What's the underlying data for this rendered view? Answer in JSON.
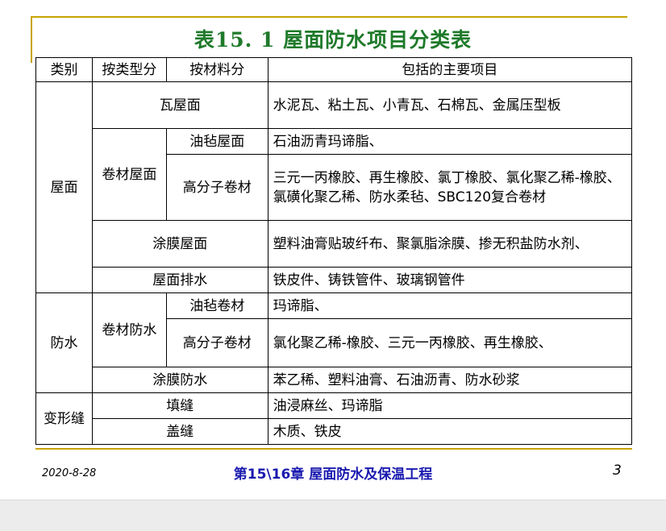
{
  "title": "表15. 1  屋面防水项目分类表",
  "table": {
    "headers": [
      "类别",
      "按类型分",
      "按材料分",
      "包括的主要项目"
    ],
    "cat_roof": "屋面",
    "cat_waterproof": "防水",
    "cat_joint": "变形缝",
    "roof_tile": "瓦屋面",
    "roof_tile_items": "水泥瓦、粘土瓦、小青瓦、石棉瓦、金属压型板",
    "roll_roof": "卷材屋面",
    "felt_roof": "油毡屋面",
    "felt_roof_items": "石油沥青玛谛脂、",
    "polymer_roll": "高分子卷材",
    "polymer_roll_items_1": "三元一丙橡胶、再生橡胶、氯丁橡胶、氯化聚乙稀-橡胶、",
    "polymer_roll_items_2": "氯磺化聚乙稀、防水柔毡、SBC120复合卷材",
    "coating_roof": "涂膜屋面",
    "coating_roof_items": "塑料油膏贴玻纤布、聚氯脂涂膜、掺无积盐防水剂、",
    "roof_drain": "屋面排水",
    "roof_drain_items": "铁皮件、铸铁管件、玻璃钢管件",
    "roll_waterproof": "卷材防水",
    "felt_roll": "油毡卷材",
    "felt_roll_items": "玛谛脂、",
    "polymer_roll_2": "高分子卷材",
    "polymer_roll_2_items": "氯化聚乙稀-橡胶、三元一丙橡胶、再生橡胶、",
    "coating_waterproof": "涂膜防水",
    "coating_waterproof_items": "苯乙稀、塑料油膏、石油沥青、防水砂浆",
    "fill_joint": "填缝",
    "fill_joint_items": "油浸麻丝、玛谛脂",
    "cover_joint": "盖缝",
    "cover_joint_items": "木质、铁皮"
  },
  "footer": {
    "date": "2020-8-28",
    "chapter": "第15\\16章 屋面防水及保温工程",
    "page": "3"
  },
  "colors": {
    "title": "#1e7a2a",
    "accent_rule": "#c8a400",
    "footer_center": "#1a1ab0"
  }
}
